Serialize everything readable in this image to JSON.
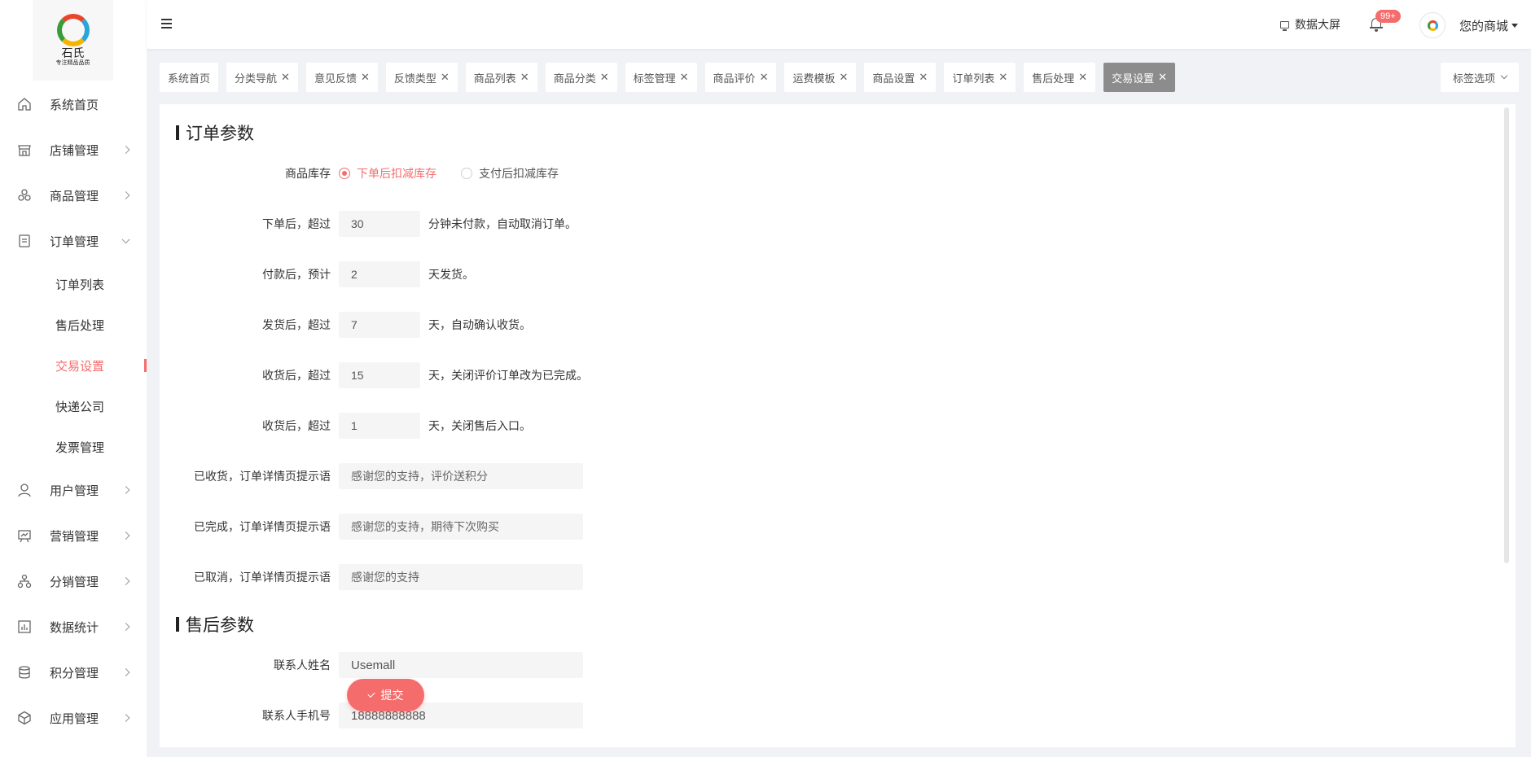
{
  "logo": {
    "name": "石氏",
    "tagline": "专注精品品质"
  },
  "menu": [
    {
      "label": "系统首页",
      "icon": "home-icon"
    },
    {
      "label": "店铺管理",
      "icon": "store-icon"
    },
    {
      "label": "商品管理",
      "icon": "product-icon"
    },
    {
      "label": "订单管理",
      "icon": "order-icon",
      "expanded": true,
      "children": [
        "订单列表",
        "售后处理",
        "交易设置",
        "快递公司",
        "发票管理"
      ],
      "active_child": "交易设置"
    },
    {
      "label": "用户管理",
      "icon": "user-icon"
    },
    {
      "label": "营销管理",
      "icon": "marketing-icon"
    },
    {
      "label": "分销管理",
      "icon": "distribution-icon"
    },
    {
      "label": "数据统计",
      "icon": "chart-icon"
    },
    {
      "label": "积分管理",
      "icon": "points-icon"
    },
    {
      "label": "应用管理",
      "icon": "app-icon"
    }
  ],
  "header": {
    "data_screen": "数据大屏",
    "notify_badge": "99+",
    "user_name": "您的商城"
  },
  "tags": [
    "系统首页",
    "分类导航",
    "意见反馈",
    "反馈类型",
    "商品列表",
    "商品分类",
    "标签管理",
    "商品评价",
    "运费模板",
    "商品设置",
    "订单列表",
    "售后处理",
    "交易设置"
  ],
  "tags_active": "交易设置",
  "tag_options": "标签选项",
  "order_params": {
    "title": "订单参数",
    "stock_label": "商品库存",
    "stock_options": [
      "下单后扣减库存",
      "支付后扣减库存"
    ],
    "stock_selected": "下单后扣减库存",
    "cancel": {
      "label": "下单后，超过",
      "value": "30",
      "suffix": "分钟未付款，自动取消订单。"
    },
    "ship": {
      "label": "付款后，预计",
      "value": "2",
      "suffix": "天发货。"
    },
    "confirm": {
      "label": "发货后，超过",
      "value": "7",
      "suffix": "天，自动确认收货。"
    },
    "review": {
      "label": "收货后，超过",
      "value": "15",
      "suffix": "天，关闭评价订单改为已完成。"
    },
    "aftersale": {
      "label": "收货后，超过",
      "value": "1",
      "suffix": "天，关闭售后入口。"
    },
    "received_tip": {
      "label": "已收货，订单详情页提示语",
      "placeholder": "感谢您的支持，评价送积分"
    },
    "completed_tip": {
      "label": "已完成，订单详情页提示语",
      "placeholder": "感谢您的支持，期待下次购买"
    },
    "cancelled_tip": {
      "label": "已取消，订单详情页提示语",
      "placeholder": "感谢您的支持"
    }
  },
  "aftersale_params": {
    "title": "售后参数",
    "contact_name": {
      "label": "联系人姓名",
      "value": "Usemall"
    },
    "contact_phone": {
      "label": "联系人手机号",
      "value": "18888888888"
    }
  },
  "submit_label": "提交"
}
